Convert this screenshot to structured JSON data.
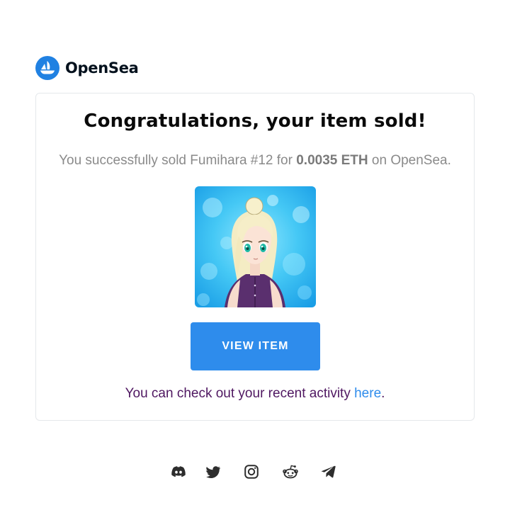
{
  "brand": {
    "name": "OpenSea",
    "logo_icon": "opensea-boat-icon",
    "color": "#2081e2"
  },
  "email": {
    "title": "Congratulations, your item sold!",
    "sale": {
      "prefix": "You successfully sold Fumihara #12 for ",
      "price": "0.0035 ETH",
      "suffix": " on OpenSea."
    },
    "item_image_alt": "anime-character-nft-icon",
    "view_button_label": "VIEW ITEM",
    "activity": {
      "prefix": "You can check out your recent activity ",
      "link_label": "here",
      "suffix": "."
    }
  },
  "socials": [
    {
      "icon": "discord-icon"
    },
    {
      "icon": "twitter-icon"
    },
    {
      "icon": "instagram-icon"
    },
    {
      "icon": "reddit-icon"
    },
    {
      "icon": "telegram-icon"
    }
  ],
  "colors": {
    "button": "#2e8cec",
    "link": "#2e8cec",
    "activity_text": "#4f1761",
    "muted_text": "#8a8a8a"
  }
}
